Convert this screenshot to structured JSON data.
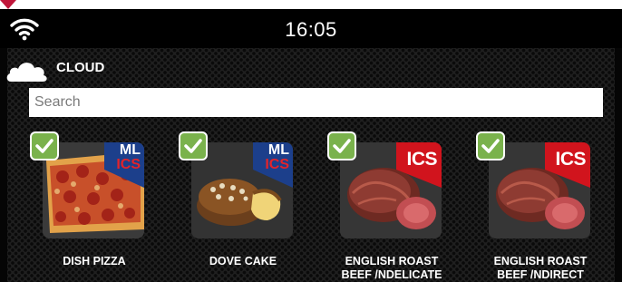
{
  "status_bar": {
    "time": "16:05",
    "icon": "wifi-icon"
  },
  "source": {
    "icon": "cloud-icon",
    "label": "CLOUD"
  },
  "search": {
    "placeholder": "Search",
    "value": ""
  },
  "recipes": [
    {
      "name_line1": "DISH PIZZA",
      "name_line2": "",
      "badge": {
        "type": "ml-ics",
        "line1": "ML",
        "line2": "ICS"
      },
      "selected": true,
      "image": "pizza"
    },
    {
      "name_line1": "DOVE CAKE",
      "name_line2": "",
      "badge": {
        "type": "ml-ics",
        "line1": "ML",
        "line2": "ICS"
      },
      "selected": true,
      "image": "dove-cake"
    },
    {
      "name_line1": "ENGLISH ROAST",
      "name_line2": "BEEF /NDELICATE",
      "badge": {
        "type": "ics",
        "line1": "ICS"
      },
      "selected": true,
      "image": "roast-beef"
    },
    {
      "name_line1": "ENGLISH ROAST",
      "name_line2": "BEEF /NDIRECT",
      "badge": {
        "type": "ics",
        "line1": "ICS"
      },
      "selected": true,
      "image": "roast-beef"
    }
  ],
  "colors": {
    "check_green": "#7ab24c",
    "ics_red": "#d1141d",
    "ml_blue": "#1c3f8b"
  }
}
